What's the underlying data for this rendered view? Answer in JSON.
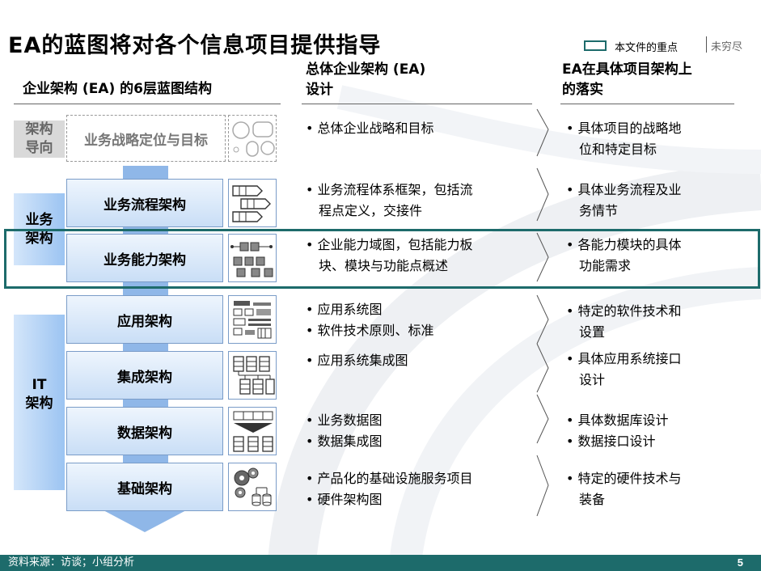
{
  "title": "EA的蓝图将对各个信息项目提供指导",
  "legend": {
    "focus_label": "本文件的重点",
    "draft_label": "未穷尽"
  },
  "headers": {
    "ea_structure": "企业架构 (EA) 的6层蓝图结构",
    "overall_line1": "总体企业架构 (EA)",
    "overall_line2": "设计",
    "project_line1": "EA在具体项目架构上",
    "project_line2": "的落实"
  },
  "side_labels": {
    "guide": [
      "架构",
      "导向"
    ],
    "business": [
      "业务",
      "架构"
    ],
    "it": [
      "IT",
      "架构"
    ]
  },
  "rows": [
    {
      "layer": "业务战略定位与目标",
      "icon": "strategy-icon",
      "overall": [
        "• 总体企业战略和目标"
      ],
      "project": [
        "• 具体项目的战略地",
        "位和特定目标"
      ]
    },
    {
      "layer": "业务流程架构",
      "icon": "process-chevron-icon",
      "overall": [
        "• 业务流程体系框架，包括流",
        "程点定义，交接件"
      ],
      "project": [
        "• 具体业务流程及业",
        "务情节"
      ]
    },
    {
      "layer": "业务能力架构",
      "icon": "capability-blocks-icon",
      "overall": [
        "• 企业能力域图，包括能力板",
        "块、模块与功能点概述"
      ],
      "project": [
        "• 各能力模块的具体",
        "功能需求"
      ]
    },
    {
      "layer": "应用架构",
      "icon": "application-map-icon",
      "overall": [
        "• 应用系统图",
        "• 软件技术原则、标准"
      ],
      "project": [
        "• 特定的软件技术和",
        "设置"
      ]
    },
    {
      "layer": "集成架构",
      "icon": "integration-icon",
      "overall": [
        "• 应用系统集成图"
      ],
      "project": [
        "• 具体应用系统接口",
        "设计"
      ]
    },
    {
      "layer": "数据架构",
      "icon": "data-icon",
      "overall": [
        "• 业务数据图",
        "• 数据集成图"
      ],
      "project": [
        "• 具体数据库设计",
        "• 数据接口设计"
      ]
    },
    {
      "layer": "基础架构",
      "icon": "infrastructure-gears-icon",
      "overall": [
        "• 产品化的基础设施服务项目",
        "• 硬件架构图"
      ],
      "project": [
        "• 特定的硬件技术与",
        "装备"
      ]
    }
  ],
  "footer": {
    "source": "资料来源：访谈；小组分析",
    "page": "5"
  },
  "colors": {
    "accent": "#1d6b6b",
    "flow_blue": "#8fb7e8",
    "box_border": "#7a9cc8"
  }
}
